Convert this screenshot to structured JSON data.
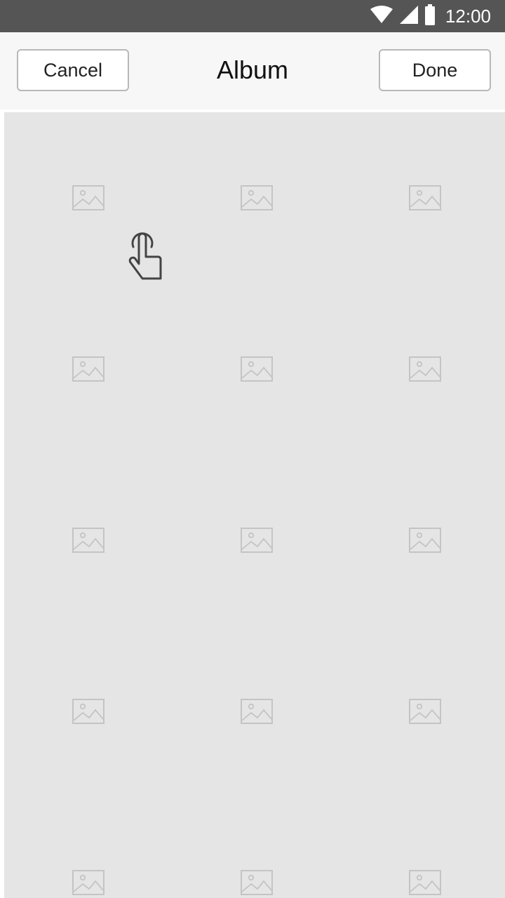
{
  "status_bar": {
    "time": "12:00",
    "icons": [
      "wifi-icon",
      "cell-signal-icon",
      "battery-icon"
    ],
    "background": "#555555"
  },
  "header": {
    "cancel_label": "Cancel",
    "title": "Album",
    "done_label": "Done"
  },
  "album": {
    "rows": 5,
    "columns": 3,
    "placeholder_icon": "image-placeholder-icon",
    "background": "#e5e5e5"
  },
  "gesture_hint": {
    "icon": "tap-hand-icon"
  }
}
